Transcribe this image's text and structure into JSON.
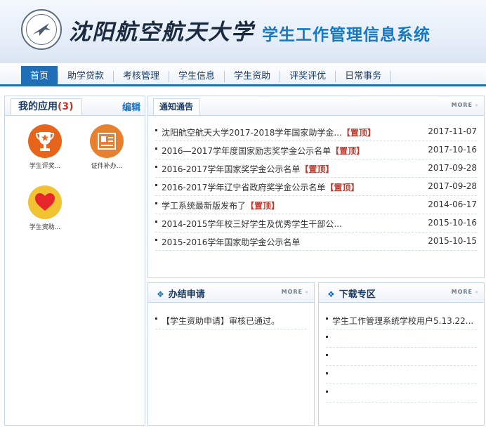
{
  "header": {
    "school_name": "沈阳航空航天大学",
    "system_name": "学生工作管理信息系统"
  },
  "nav": {
    "items": [
      "首页",
      "助学贷款",
      "考核管理",
      "学生信息",
      "学生资助",
      "评奖评优",
      "日常事务"
    ],
    "active_index": 0
  },
  "my_apps": {
    "title": "我的应用",
    "count": "(3)",
    "edit_label": "编辑",
    "apps": [
      {
        "label": "学生评奖...",
        "icon": "trophy-icon",
        "color": "#e8641b"
      },
      {
        "label": "证件补办...",
        "icon": "certificate-icon",
        "color": "#e8812f"
      },
      {
        "label": "学生资助...",
        "icon": "heart-icon",
        "color": "#f1c232"
      }
    ]
  },
  "notices": {
    "tab_label": "通知通告",
    "more_label": "MORE",
    "top_tag": "【置顶】",
    "items": [
      {
        "title": "沈阳航空航天大学2017-2018学年国家助学金...",
        "pinned": true,
        "date": "2017-11-07"
      },
      {
        "title": "2016—2017学年度国家励志奖学金公示名单",
        "pinned": true,
        "date": "2017-10-16"
      },
      {
        "title": "2016-2017学年国家奖学金公示名单",
        "pinned": true,
        "date": "2017-09-28"
      },
      {
        "title": "2016-2017学年辽宁省政府奖学金公示名单",
        "pinned": true,
        "date": "2017-09-28"
      },
      {
        "title": "学工系统最新版发布了",
        "pinned": true,
        "date": "2014-06-17"
      },
      {
        "title": "2014-2015学年校三好学生及优秀学生干部公...",
        "pinned": false,
        "date": "2015-10-16"
      },
      {
        "title": "2015-2016学年国家助学金公示名单",
        "pinned": false,
        "date": "2015-10-15"
      }
    ]
  },
  "done_requests": {
    "title": "办结申请",
    "more_label": "MORE",
    "items": [
      "【学生资助申请】审核已通过。"
    ]
  },
  "downloads": {
    "title": "下载专区",
    "more_label": "MORE",
    "items": [
      "学生工作管理系统学校用户5.13.22...",
      "",
      "",
      "",
      ""
    ]
  },
  "colors": {
    "accent": "#1e6fb8",
    "pinned": "#c0392b"
  }
}
